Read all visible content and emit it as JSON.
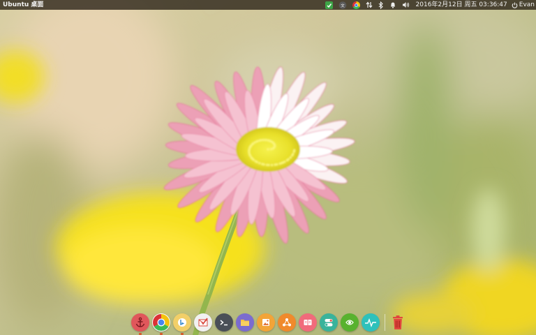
{
  "panel": {
    "app_title": "Ubuntu 桌面",
    "clock": "2016年2月12日 周五 03:36:47",
    "user": "Evan",
    "indicators": [
      "app-indicator-icon",
      "keyboard-layout-icon",
      "chrome-tray-icon",
      "network-icon",
      "bluetooth-icon",
      "notification-bell-icon",
      "volume-icon"
    ]
  },
  "dock": {
    "items": [
      {
        "name": "anchor-app",
        "icon": "anchor-icon",
        "color": "#e0575b",
        "running": true
      },
      {
        "name": "chrome",
        "icon": "chrome-icon",
        "color": "#ffffff",
        "running": true
      },
      {
        "name": "bing-app",
        "icon": "bing-icon",
        "color": "#f2cf68",
        "running": true
      },
      {
        "name": "mail-app",
        "icon": "mail-check-icon",
        "color": "#f1f1f1",
        "running": false
      },
      {
        "name": "terminal",
        "icon": "terminal-icon",
        "color": "#4a4f57",
        "running": false
      },
      {
        "name": "file-manager",
        "icon": "folder-icon",
        "color": "#7b6ccf",
        "running": false
      },
      {
        "name": "image-viewer",
        "icon": "image-viewer-icon",
        "color": "#f2a438",
        "running": false
      },
      {
        "name": "share-app",
        "icon": "share-icon",
        "color": "#f08a2c",
        "running": false
      },
      {
        "name": "reader-app",
        "icon": "reader-icon",
        "color": "#f16b7b",
        "running": false
      },
      {
        "name": "settings-toggle",
        "icon": "toggle-icon",
        "color": "#39b39b",
        "running": false
      },
      {
        "name": "nvidia-settings",
        "icon": "nvidia-icon",
        "color": "#58b22e",
        "running": false
      },
      {
        "name": "system-monitor",
        "icon": "pulse-icon",
        "color": "#2ec1bb",
        "running": false
      },
      {
        "name": "trash",
        "icon": "trash-icon",
        "color": "#e2463e",
        "running": false
      }
    ]
  }
}
